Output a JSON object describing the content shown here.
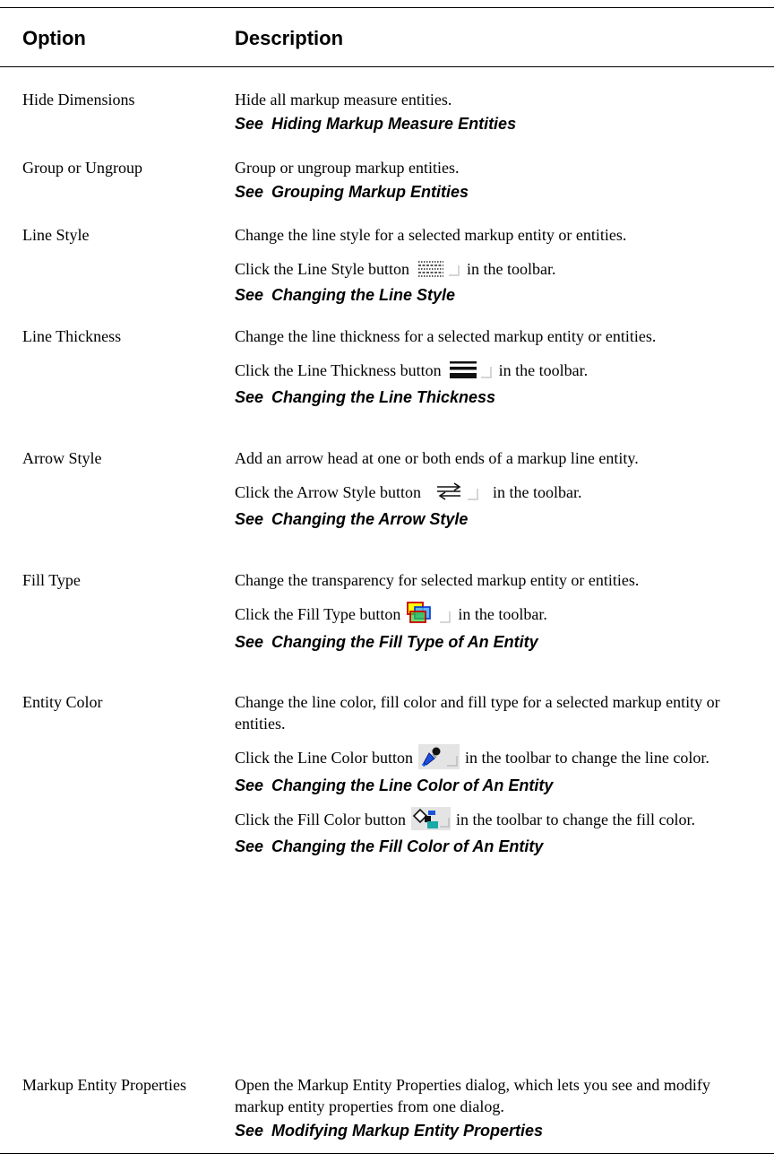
{
  "header": {
    "option": "Option",
    "description": "Description"
  },
  "rows": [
    {
      "option": "Hide Dimensions",
      "desc": "Hide all markup measure entities.",
      "see_label": "See",
      "see_link": "Hiding Markup Measure Entities"
    },
    {
      "option": "Group or Ungroup",
      "desc": "Group or ungroup markup entities.",
      "see_label": "See",
      "see_link": "Grouping Markup Entities"
    },
    {
      "option": "Line Style",
      "desc": "Change the line style for a selected markup entity or entities.",
      "click_before": "Click the Line Style button",
      "click_after": "in the toolbar.",
      "icon": "line-style-icon",
      "see_label": "See",
      "see_link": "Changing the Line Style"
    },
    {
      "option": "Line Thickness",
      "desc": "Change the line thickness for a selected markup entity or entities.",
      "click_before": "Click the Line Thickness button",
      "click_after": "in the toolbar.",
      "icon": "line-thickness-icon",
      "see_label": "See",
      "see_link": "Changing the Line Thickness"
    },
    {
      "option": "Arrow Style",
      "desc": "Add an arrow head at one or both ends of a markup line entity.",
      "click_before": "Click the Arrow Style button",
      "click_after": "in the toolbar.",
      "icon": "arrow-style-icon",
      "see_label": "See",
      "see_link": "Changing the Arrow Style"
    },
    {
      "option": "Fill Type",
      "desc": "Change the transparency for selected markup entity or entities.",
      "click_before": "Click the Fill Type button",
      "click_after": "in the toolbar.",
      "icon": "fill-type-icon",
      "see_label": "See",
      "see_link": "Changing the Fill Type of An Entity"
    },
    {
      "option": "Entity Color",
      "desc": "Change the line color, fill color and fill type for a selected markup entity or entities.",
      "click_before": "Click the Line Color button",
      "click_after": "in the toolbar to change the line color.",
      "icon": "line-color-icon",
      "see_label": "See",
      "see_link": "Changing the Line Color of An Entity",
      "click2_before": "Click the Fill Color button",
      "click2_after": "in the toolbar to change the fill color.",
      "icon2": "fill-color-icon",
      "see2_label": "See",
      "see2_link": "Changing the Fill Color of An Entity"
    },
    {
      "option": "Markup Entity Properties",
      "desc": "Open the Markup Entity Properties dialog, which lets you see and modify markup entity properties from one dialog.",
      "see_label": "See",
      "see_link": "Modifying Markup Entity Properties"
    }
  ]
}
